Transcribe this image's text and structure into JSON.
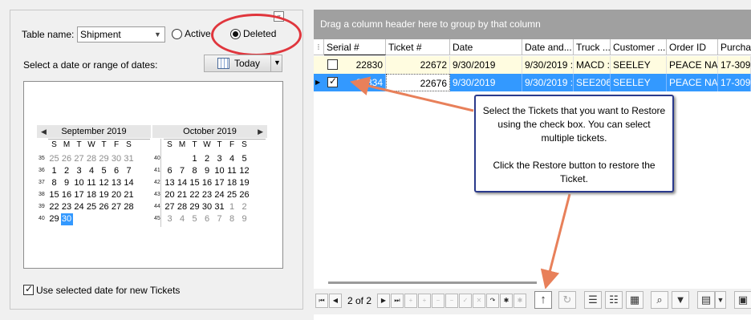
{
  "left": {
    "table_name_label": "Table name:",
    "table_name_value": "Shipment",
    "active_label": "Active",
    "deleted_label": "Deleted",
    "date_prompt": "Select a date or range of dates:",
    "today_label": "Today",
    "use_date_label": "Use selected date for new Tickets"
  },
  "calendar": {
    "month1_title": "September 2019",
    "month2_title": "October 2019",
    "dow": [
      "S",
      "M",
      "T",
      "W",
      "T",
      "F",
      "S"
    ],
    "weeks1": [
      "35",
      "36",
      "37",
      "38",
      "39",
      "40"
    ],
    "weeks2": [
      "40",
      "41",
      "42",
      "43",
      "44",
      "45"
    ],
    "month1_days": [
      [
        "25",
        "26",
        "27",
        "28",
        "29",
        "30",
        "31"
      ],
      [
        "1",
        "2",
        "3",
        "4",
        "5",
        "6",
        "7"
      ],
      [
        "8",
        "9",
        "10",
        "11",
        "12",
        "13",
        "14"
      ],
      [
        "15",
        "16",
        "17",
        "18",
        "19",
        "20",
        "21"
      ],
      [
        "22",
        "23",
        "24",
        "25",
        "26",
        "27",
        "28"
      ],
      [
        "29",
        "30",
        "",
        "",
        "",
        "",
        ""
      ]
    ],
    "month2_days": [
      [
        "",
        "",
        "1",
        "2",
        "3",
        "4",
        "5"
      ],
      [
        "6",
        "7",
        "8",
        "9",
        "10",
        "11",
        "12"
      ],
      [
        "13",
        "14",
        "15",
        "16",
        "17",
        "18",
        "19"
      ],
      [
        "20",
        "21",
        "22",
        "23",
        "24",
        "25",
        "26"
      ],
      [
        "27",
        "28",
        "29",
        "30",
        "31",
        "1",
        "2"
      ],
      [
        "3",
        "4",
        "5",
        "6",
        "7",
        "8",
        "9"
      ]
    ],
    "selected_day": "30"
  },
  "grid": {
    "group_hint": "Drag a column header here to group by that column",
    "columns": [
      "Serial #",
      "Ticket #",
      "Date",
      "Date and...",
      "Truck ...",
      "Customer ...",
      "Order ID",
      "Purcha"
    ],
    "rows": [
      {
        "checked": false,
        "serial": "22830",
        "ticket": "22672",
        "date": "9/30/2019",
        "date_and": "9/30/2019 :",
        "truck": "MACD :",
        "customer": "SEELEY",
        "order": "PEACE NAT",
        "purchase": "17-309"
      },
      {
        "checked": true,
        "serial": "22834",
        "ticket": "22676",
        "date": "9/30/2019",
        "date_and": "9/30/2019 :",
        "truck": "SEE206",
        "customer": "SEELEY",
        "order": "PEACE NAT",
        "purchase": "17-309"
      }
    ]
  },
  "callout": {
    "line1": "Select the Tickets that you want to Restore using the check box. You can select multiple tickets.",
    "line2": "Click the Restore button to restore the Ticket."
  },
  "navigator": {
    "page_text": "2 of 2"
  }
}
